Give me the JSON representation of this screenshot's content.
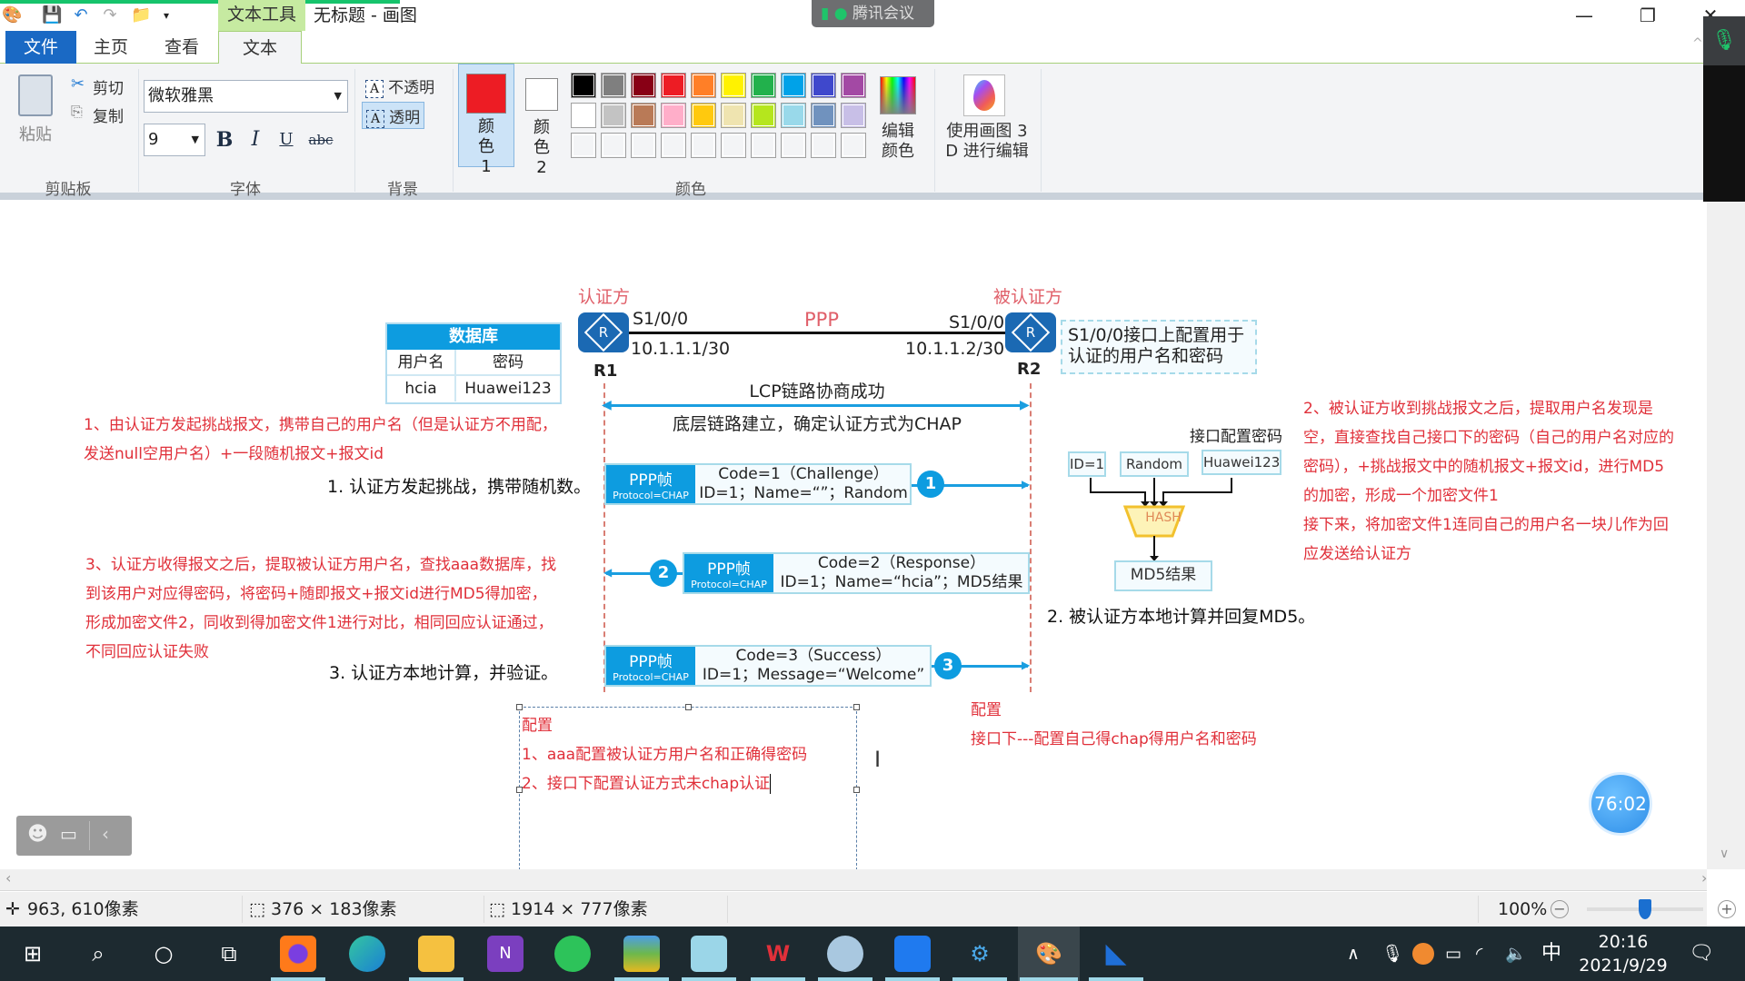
{
  "window": {
    "title": "无标题 - 画图",
    "context_tab": "文本工具",
    "meeting_app": "腾讯会议",
    "controls": {
      "minimize": "—",
      "restore": "❐",
      "close": "✕"
    }
  },
  "quick_access": {
    "icons": [
      "paint-app-icon",
      "save-icon",
      "undo-icon",
      "redo-icon",
      "folder-icon",
      "customize-dropdown-icon"
    ]
  },
  "tabs": [
    {
      "label": "文件"
    },
    {
      "label": "主页"
    },
    {
      "label": "查看"
    },
    {
      "label": "文本"
    }
  ],
  "ribbon": {
    "clipboard": {
      "paste": "粘贴",
      "cut": "剪切",
      "copy": "复制",
      "group": "剪贴板"
    },
    "font": {
      "family": "微软雅黑",
      "size": "9",
      "bold": "B",
      "italic": "I",
      "underline": "U",
      "strikethrough": "abc",
      "group": "字体"
    },
    "background": {
      "opaque": "不透明",
      "transparent": "透明",
      "group": "背景"
    },
    "colors": {
      "color1_label": "颜色 1",
      "color2_label": "颜色 2",
      "color1": "#ed1c24",
      "color2": "#ffffff",
      "palette_row1": [
        "#000000",
        "#7f7f7f",
        "#880015",
        "#ed1c24",
        "#ff7f27",
        "#fff200",
        "#22b14c",
        "#00a2e8",
        "#3f48cc",
        "#a349a4"
      ],
      "palette_row2": [
        "#ffffff",
        "#c3c3c3",
        "#b97a57",
        "#ffaec9",
        "#ffc90e",
        "#efe4b0",
        "#b5e61d",
        "#99d9ea",
        "#7092be",
        "#c8bfe7"
      ],
      "edit_colors": "编辑颜色",
      "group": "颜色"
    },
    "paint3d": {
      "label": "使用画图 3 D 进行编辑"
    }
  },
  "diagram": {
    "authenticator_label": "认证方",
    "authenticatee_label": "被认证方",
    "link_label": "PPP",
    "r1": {
      "name": "R1",
      "iface": "S1/0/0",
      "ip": "10.1.1.1/30",
      "glyph": "R"
    },
    "r2": {
      "name": "R2",
      "iface": "S1/0/0",
      "ip": "10.1.1.2/30",
      "glyph": "R"
    },
    "database": {
      "title": "数据库",
      "headers": [
        "用户名",
        "密码"
      ],
      "rows": [
        [
          "hcia",
          "Huawei123"
        ]
      ]
    },
    "r2_note": "S1/0/0接口上配置用于认证的用户名和密码",
    "lcp_top": "LCP链路协商成功",
    "lcp_bottom": "底层链路建立，确定认证方式为CHAP",
    "frames": [
      {
        "header": "PPP帧",
        "proto": "Protocol=CHAP",
        "line1": "Code=1（Challenge）",
        "line2": "ID=1；Name=“”；Random",
        "step": "1"
      },
      {
        "header": "PPP帧",
        "proto": "Protocol=CHAP",
        "line1": "Code=2（Response）",
        "line2": "ID=1；Name=“hcia”；MD5结果",
        "step": "2"
      },
      {
        "header": "PPP帧",
        "proto": "Protocol=CHAP",
        "line1": "Code=3（Success）",
        "line2": "ID=1；Message=“Welcome”",
        "step": "3"
      }
    ],
    "step_captions": [
      "1. 认证方发起挑战，携带随机数。",
      "2. 被认证方本地计算并回复MD5。",
      "3. 认证方本地计算，并验证。"
    ],
    "hash": {
      "iface_pwd_label": "接口配置密码",
      "inputs": [
        "ID=1",
        "Random",
        "Huawei123"
      ],
      "func": "HASH",
      "output": "MD5结果"
    }
  },
  "annotations": {
    "note1": [
      "1、由认证方发起挑战报文，携带自己的用户名（但是认证方不用配，",
      "发送null空用户名）+一段随机报文+报文id"
    ],
    "note2": [
      "2、被认证方收到挑战报文之后，提取用户名发现是",
      "空，直接查找自己接口下的密码（自己的用户名对应的",
      "密码），+挑战报文中的随机报文+报文id，进行MD5",
      "的加密，形成一个加密文件1",
      "接下来，将加密文件1连同自己的用户名一块儿作为回",
      "应发送给认证方"
    ],
    "note3": [
      "3、认证方收得报文之后，提取被认证方用户名，查找aaa数据库，找",
      "到该用户对应得密码，将密码+随即报文+报文id进行MD5得加密，",
      "形成加密文件2，同收到得加密文件1进行对比，相同回应认证通过，",
      "不同回应认证失败"
    ],
    "config_left": [
      "配置",
      "1、aaa配置被认证方用户名和正确得密码",
      "2、接口下配置认证方式未chap认证"
    ],
    "config_right": [
      "配置",
      "接口下---配置自己得chap得用户名和密码"
    ]
  },
  "overlay": {
    "timer": "76:02"
  },
  "statusbar": {
    "cursor_pos": "963, 610像素",
    "selection_size": "376 × 183像素",
    "canvas_size": "1914 × 777像素",
    "zoom": "100%",
    "zoom_level_percent": 100
  },
  "taskbar": {
    "apps": [
      "start",
      "search",
      "cortana",
      "task-view",
      "firefox",
      "edge",
      "file-explorer",
      "onenote",
      "wechat",
      "winrar",
      "notepad",
      "wps",
      "app-runner",
      "lark",
      "network-app",
      "paint",
      "wireshark"
    ],
    "tray": {
      "ime": "中",
      "time": "20:16",
      "date": "2021/9/29"
    }
  }
}
